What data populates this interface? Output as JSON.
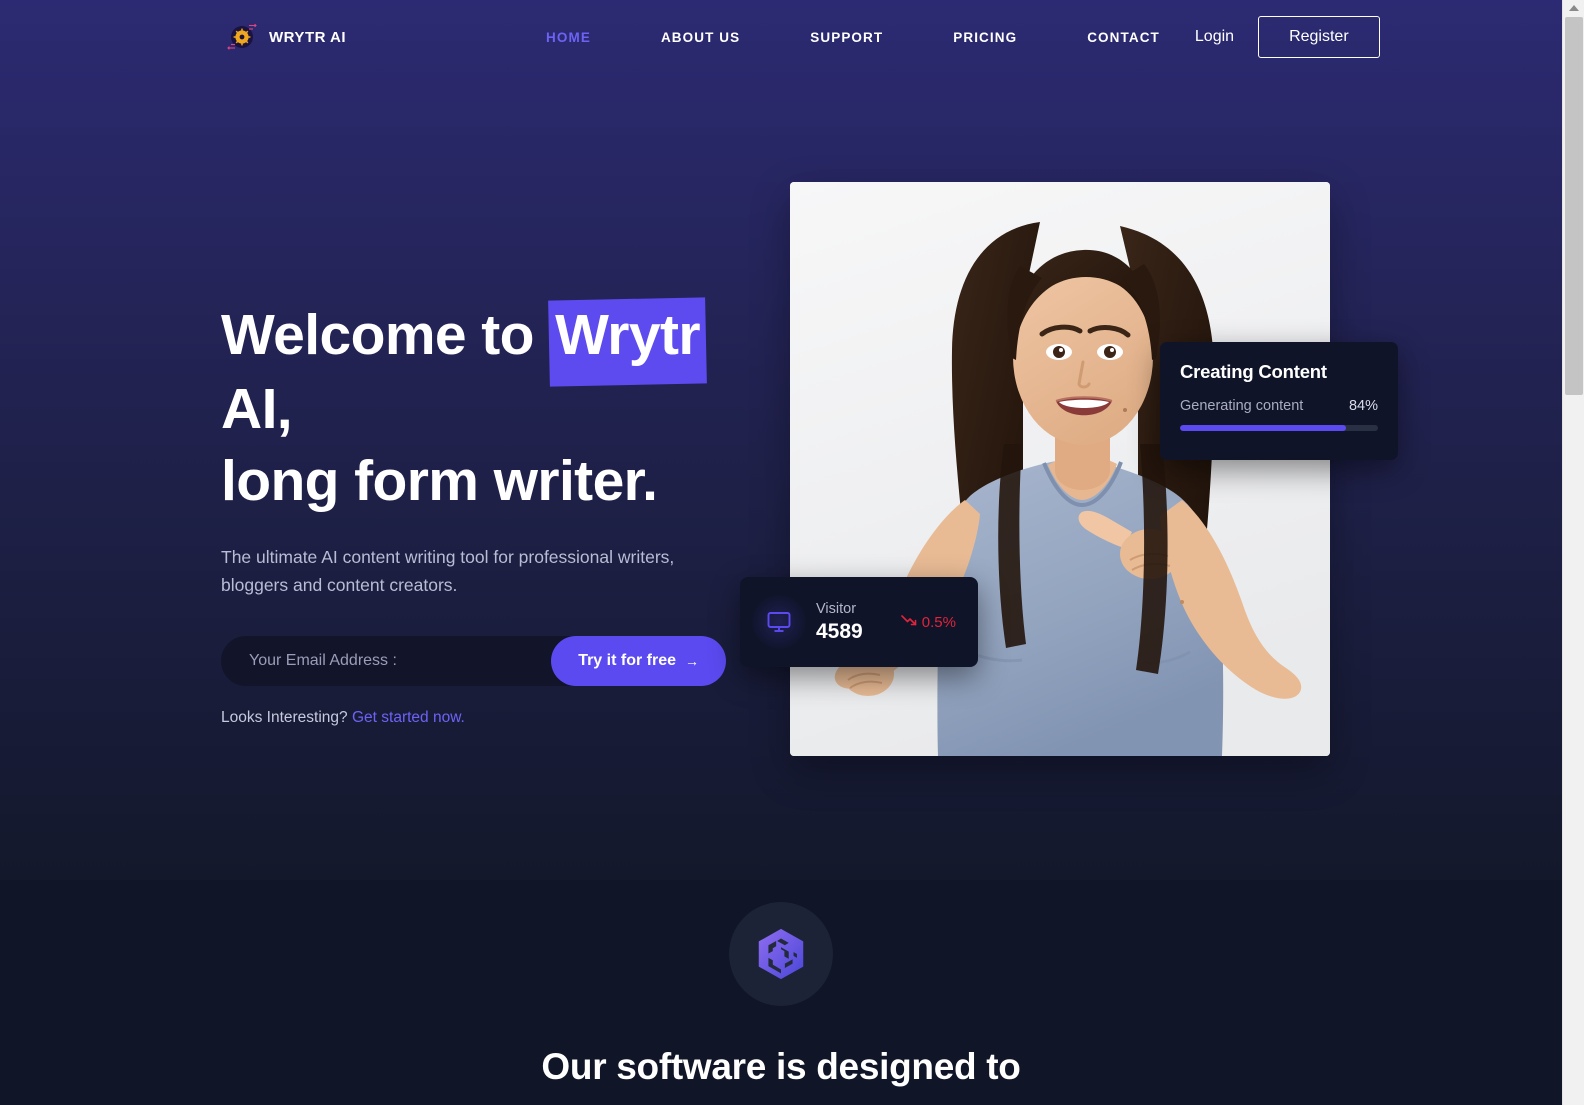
{
  "brand": {
    "name": "WRYTR AI",
    "icon": "gear-ai-logo-icon"
  },
  "nav": {
    "links": [
      {
        "label": "HOME",
        "active": true
      },
      {
        "label": "ABOUT US",
        "active": false
      },
      {
        "label": "SUPPORT",
        "active": false
      },
      {
        "label": "PRICING",
        "active": false
      },
      {
        "label": "CONTACT",
        "active": false
      }
    ],
    "login_label": "Login",
    "register_label": "Register"
  },
  "hero": {
    "headline_part1": "Welcome to",
    "headline_highlight": "Wrytr",
    "headline_part2": "AI,",
    "headline_line2": "long form writer.",
    "subhead": "The ultimate AI content writing tool for professional writers, bloggers and content creators.",
    "email_placeholder": "Your Email Address :",
    "email_value": "",
    "cta_label": "Try it for free",
    "cta_arrow": "→",
    "interest_prefix": "Looks Interesting?",
    "interest_link": "Get started now.",
    "highlight_color": "#5d4bf0",
    "accent_color": "#5b4af0"
  },
  "creating_card": {
    "title": "Creating Content",
    "status_label": "Generating content",
    "percent_label": "84%",
    "percent_value": 84,
    "bar_color": "#5b4af0"
  },
  "visitor_card": {
    "icon": "monitor-icon",
    "label": "Visitor",
    "value": "4589",
    "delta_icon": "trend-down-icon",
    "delta": "0.5%",
    "delta_color": "#e0243a"
  },
  "features": {
    "badge_icon": "hex-cube-icon",
    "heading": "Our software is designed to"
  },
  "scrollbar": {
    "up_arrow_icon": "scroll-up-arrow-icon"
  }
}
